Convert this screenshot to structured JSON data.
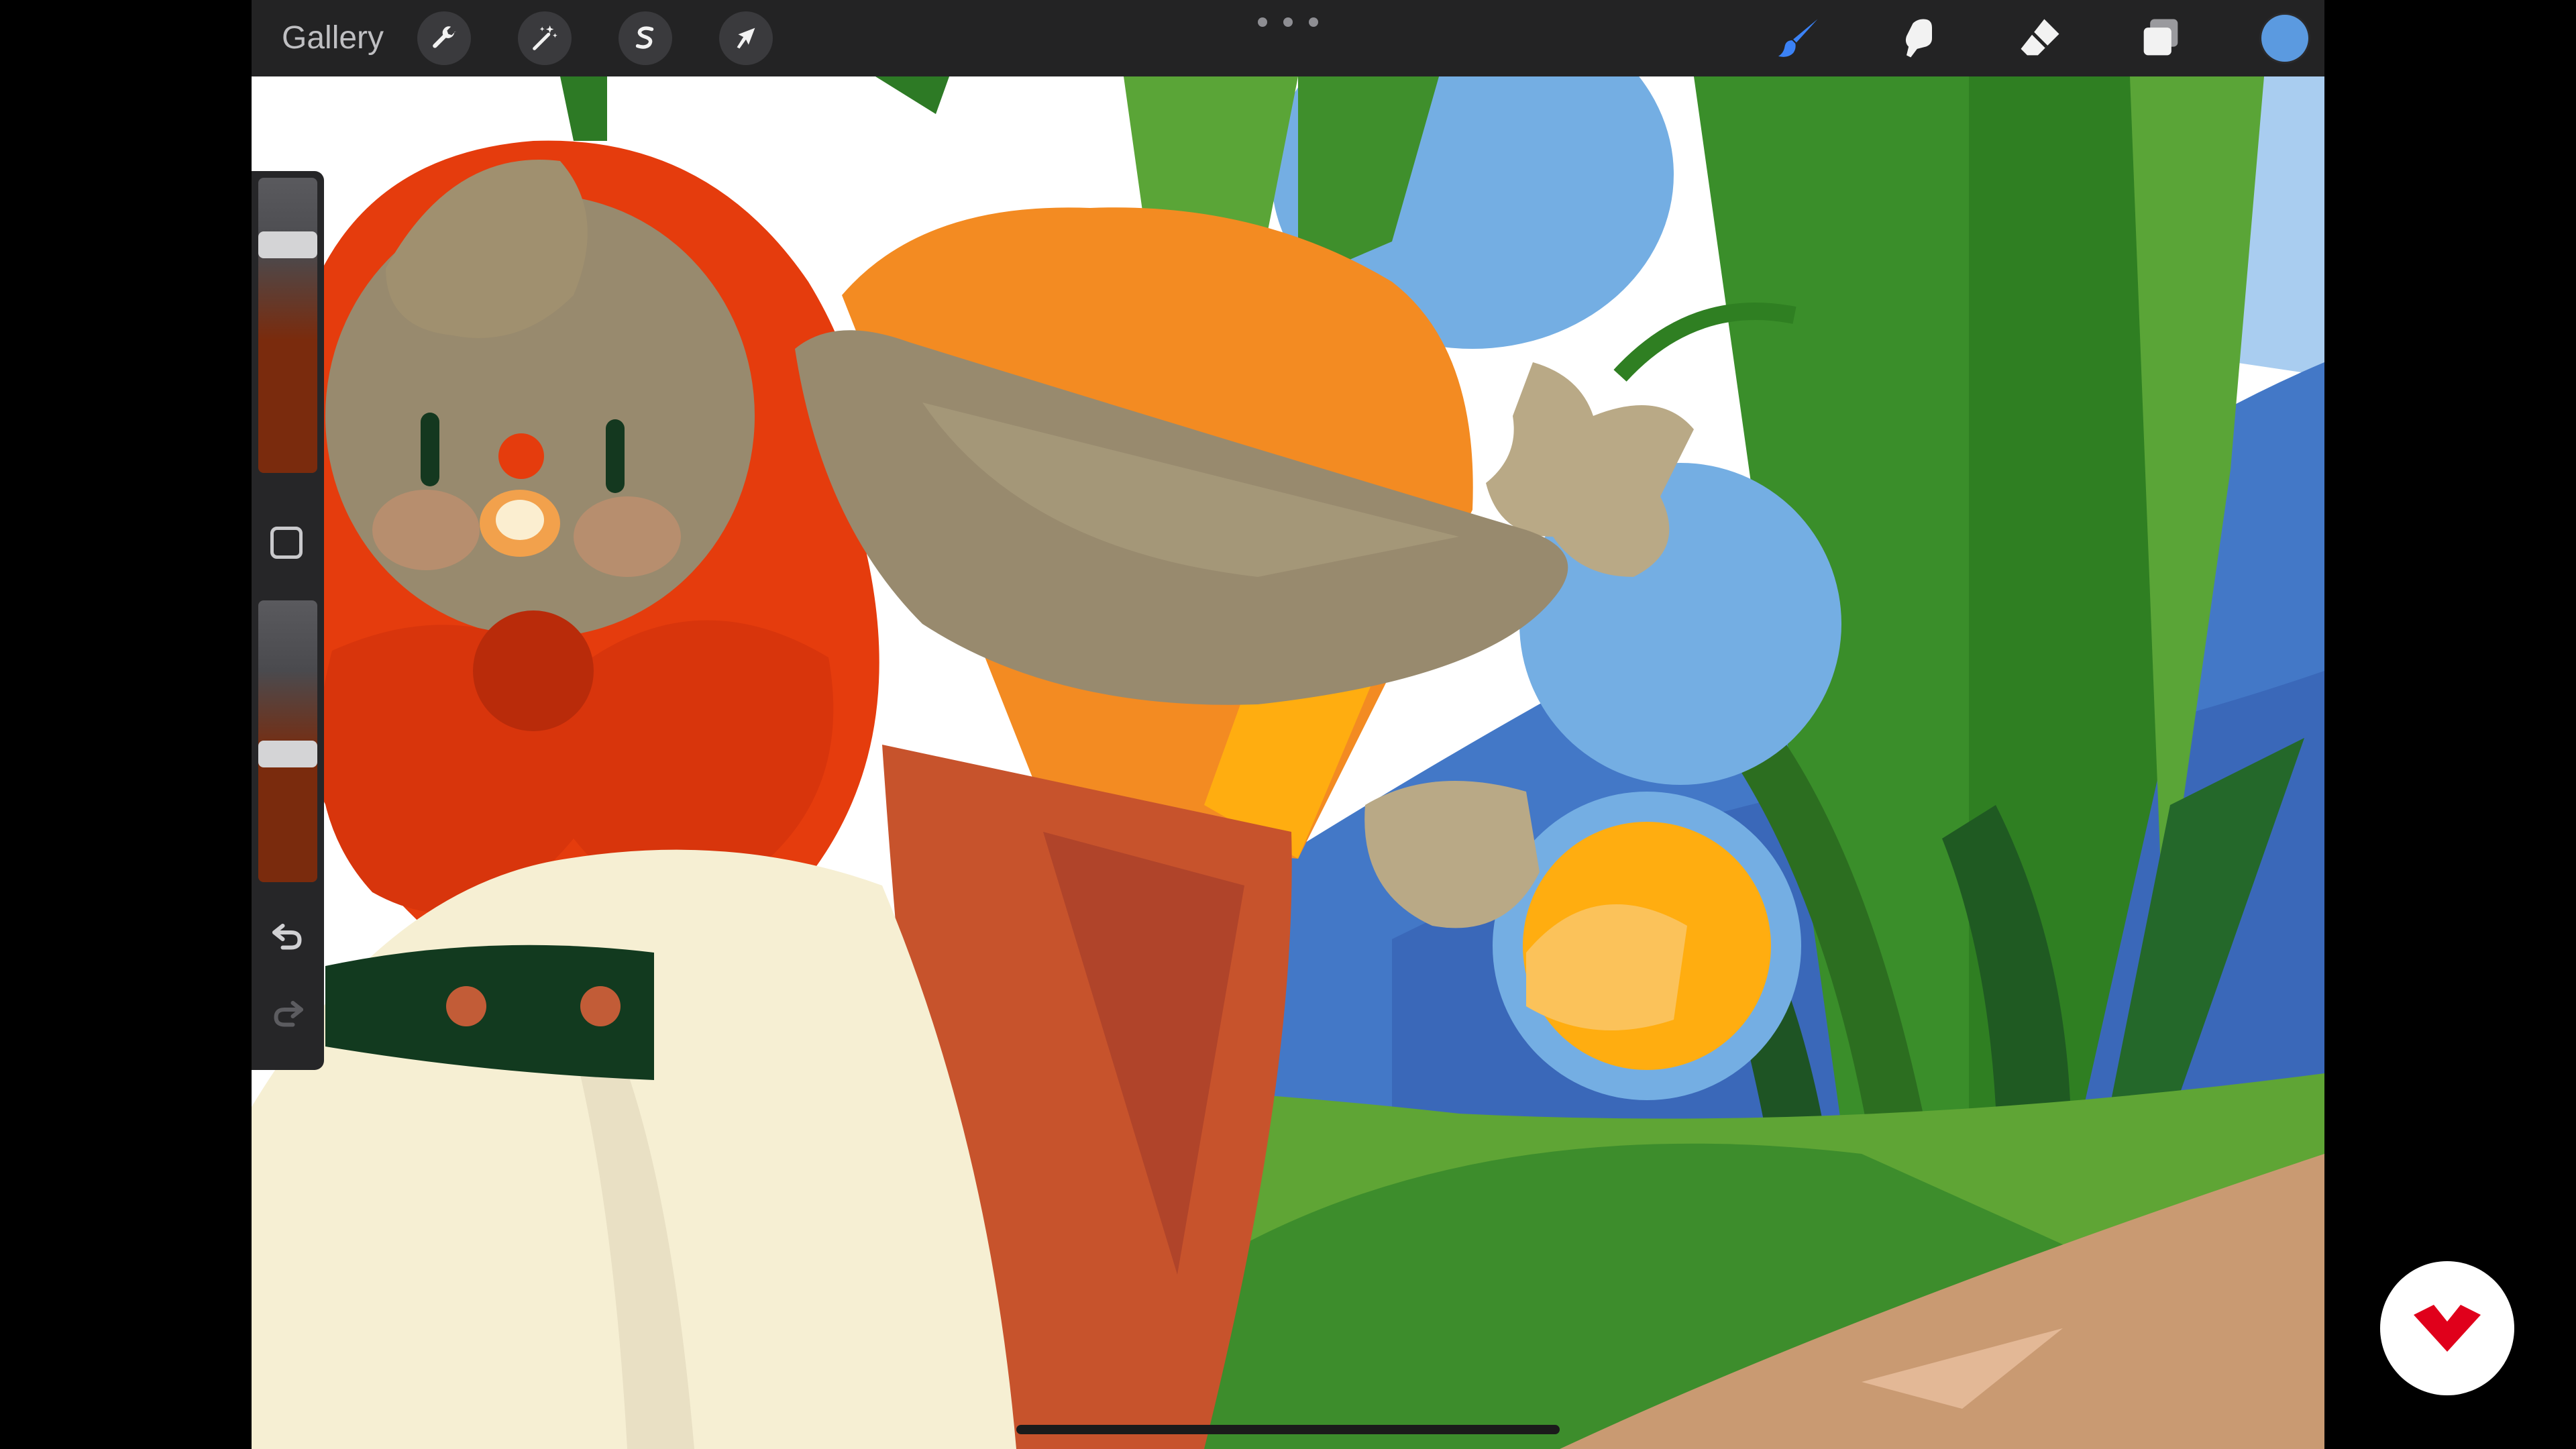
{
  "toolbar": {
    "gallery_label": "Gallery",
    "left_tools": [
      "wrench-icon",
      "magic-wand-icon",
      "selection-s-icon",
      "transform-arrow-icon"
    ],
    "right_tools": [
      "brush-icon",
      "smudge-icon",
      "eraser-icon",
      "layers-icon"
    ],
    "more_icon": "ellipsis-icon",
    "active_tool": "brush-icon",
    "active_tool_color": "#3b82f6",
    "current_color": "#5b9ae0"
  },
  "sidebar": {
    "brush_size_level": 0.8,
    "brush_opacity_level": 0.45,
    "slider_color": "#7a2b0d",
    "icons": [
      "modify-square-icon",
      "undo-icon",
      "redo-icon"
    ]
  },
  "badge": {
    "icon": "domestika-logo-icon",
    "color": "#e0001b"
  }
}
